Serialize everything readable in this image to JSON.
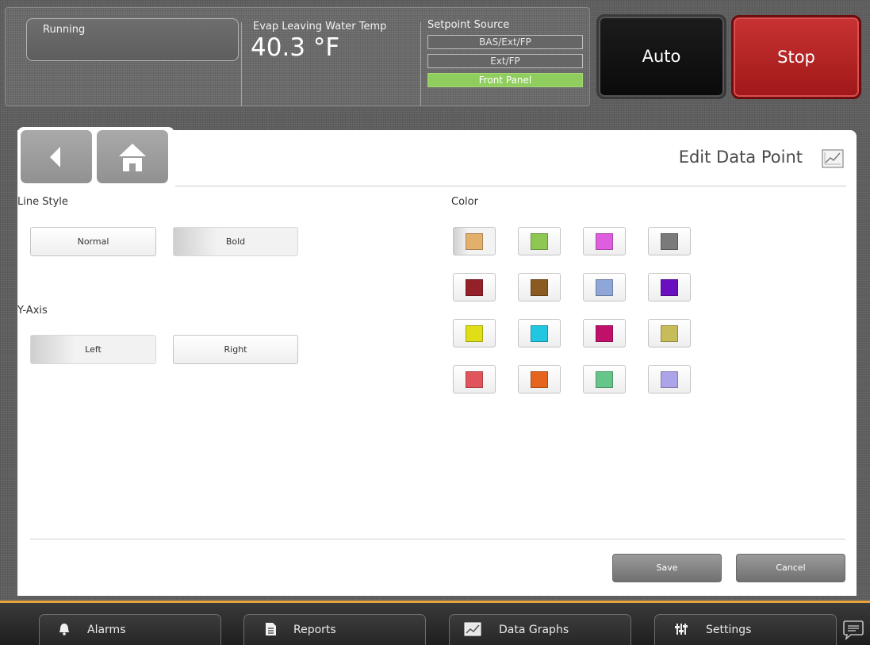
{
  "status": {
    "running": "Running",
    "temp_label": "Evap Leaving Water Temp",
    "temp_value": "40.3 °F",
    "setpoint_label": "Setpoint Source",
    "setpoint_options": [
      "BAS/Ext/FP",
      "Ext/FP",
      "Front Panel"
    ],
    "setpoint_active": "Front Panel"
  },
  "controls": {
    "auto": "Auto",
    "stop": "Stop"
  },
  "panel": {
    "title": "Edit Data Point",
    "title_icon": "data-graph-icon",
    "line_style_label": "Line Style",
    "line_style_options": [
      "Normal",
      "Bold"
    ],
    "line_style_selected": "Bold",
    "yaxis_label": "Y-Axis",
    "yaxis_options": [
      "Left",
      "Right"
    ],
    "yaxis_selected": "Left",
    "color_label": "Color",
    "colors": [
      "#e3b06c",
      "#8ec754",
      "#dd5fdf",
      "#7a7a7a",
      "#94202a",
      "#8b5a20",
      "#8fa7d8",
      "#6a0fc0",
      "#e0de16",
      "#21c6e0",
      "#c0106a",
      "#c6bc58",
      "#e2545c",
      "#e5641e",
      "#66c68a",
      "#aca4e8"
    ],
    "color_selected": "#e3b06c",
    "save": "Save",
    "cancel": "Cancel"
  },
  "footer": {
    "alarms": "Alarms",
    "reports": "Reports",
    "data_graphs": "Data Graphs",
    "settings": "Settings"
  },
  "theme": {
    "accent": "#e7a33a",
    "stop_red": "#b52222",
    "active_green": "#8fce5e"
  }
}
